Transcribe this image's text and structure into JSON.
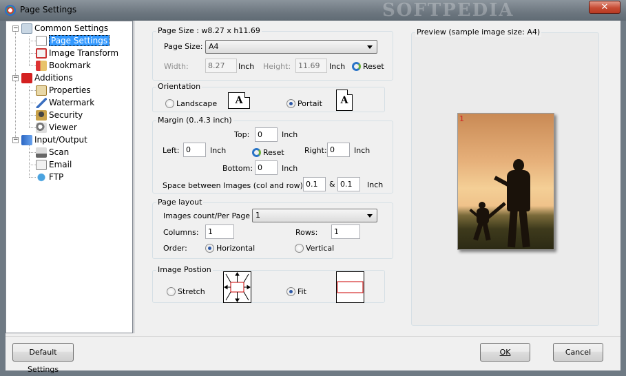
{
  "window": {
    "title": "Page Settings",
    "watermark": "SOFTPEDIA",
    "close_glyph": "✕"
  },
  "tree": {
    "expander_glyph": "−",
    "groups": [
      {
        "label": "Common Settings",
        "icon": "settings-icon",
        "children": [
          {
            "label": "Page Settings",
            "icon": "page-settings-icon",
            "selected": true
          },
          {
            "label": "Image Transform",
            "icon": "image-transform-icon"
          },
          {
            "label": "Bookmark",
            "icon": "bookmark-icon"
          }
        ]
      },
      {
        "label": "Additions",
        "icon": "pdf-icon",
        "children": [
          {
            "label": "Properties",
            "icon": "properties-icon"
          },
          {
            "label": "Watermark",
            "icon": "watermark-icon"
          },
          {
            "label": "Security",
            "icon": "security-icon"
          },
          {
            "label": "Viewer",
            "icon": "viewer-icon"
          }
        ]
      },
      {
        "label": "Input/Output",
        "icon": "input-output-icon",
        "children": [
          {
            "label": "Scan",
            "icon": "scan-icon"
          },
          {
            "label": "Email",
            "icon": "email-icon"
          },
          {
            "label": "FTP",
            "icon": "ftp-icon"
          }
        ]
      }
    ]
  },
  "page_size": {
    "group_title": "Page Size : w8.27 x h11.69",
    "label": "Page Size:",
    "value": "A4",
    "width_label": "Width:",
    "width_value": "8.27",
    "width_unit": "Inch",
    "height_label": "Height:",
    "height_value": "11.69",
    "height_unit": "Inch",
    "reset_label": "Reset"
  },
  "orientation": {
    "group_title": "Orientation",
    "landscape_label": "Landscape",
    "portrait_label": "Portait",
    "selected": "Portait",
    "icon_letter": "A"
  },
  "margin": {
    "group_title": "Margin (0..4.3 inch)",
    "top_label": "Top:",
    "top_value": "0",
    "left_label": "Left:",
    "left_value": "0",
    "right_label": "Right:",
    "right_value": "0",
    "bottom_label": "Bottom:",
    "bottom_value": "0",
    "unit": "Inch",
    "reset_label": "Reset",
    "space_label": "Space between Images (col and row) :",
    "space_col": "0.1",
    "space_amp": "&",
    "space_row": "0.1",
    "space_unit": "Inch"
  },
  "page_layout": {
    "group_title": "Page layout",
    "images_count_label": "Images count/Per Page",
    "images_count_value": "1",
    "columns_label": "Columns:",
    "columns_value": "1",
    "rows_label": "Rows:",
    "rows_value": "1",
    "order_label": "Order:",
    "horizontal_label": "Horizontal",
    "vertical_label": "Vertical",
    "selected": "Horizontal"
  },
  "image_position": {
    "group_title": "Image Postion",
    "stretch_label": "Stretch",
    "fit_label": "Fit",
    "selected": "Fit"
  },
  "preview": {
    "group_title": "Preview (sample image size: A4)",
    "page_number": "1"
  },
  "buttons": {
    "default_settings": "Default Settings",
    "ok": "OK",
    "cancel": "Cancel"
  }
}
